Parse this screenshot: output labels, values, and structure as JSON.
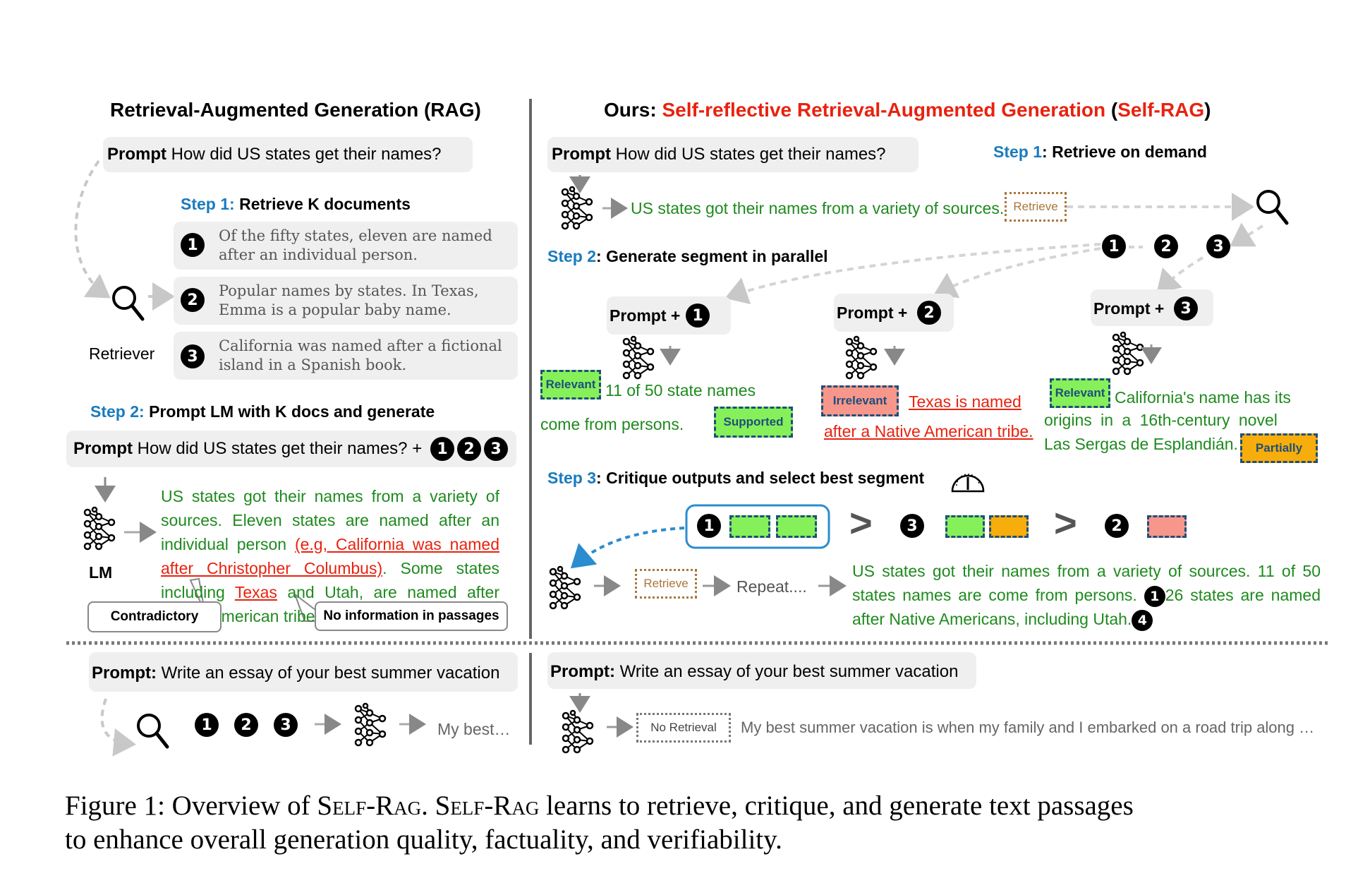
{
  "left": {
    "title": "Retrieval-Augmented Generation (RAG)",
    "prompt": {
      "label": "Prompt",
      "text": "How did US states get their names?"
    },
    "step1": {
      "step": "Step 1:",
      "text": "Retrieve K documents"
    },
    "retriever_label": "Retriever",
    "documents": [
      {
        "num": "1",
        "text": "Of the fifty states, eleven are named after an individual person."
      },
      {
        "num": "2",
        "text": "Popular names by states. In Texas, Emma is a popular baby name."
      },
      {
        "num": "3",
        "text": "California was named after a fictional island in a Spanish book."
      }
    ],
    "step2": {
      "step": "Step 2:",
      "text": "Prompt LM with K docs and generate"
    },
    "prompt2": {
      "label": "Prompt",
      "text": "How did US states get their names? +",
      "nums": [
        "1",
        "2",
        "3"
      ]
    },
    "lm_label": "LM",
    "generation": {
      "part1": "US states got their names from a variety of sources. Eleven states are named after an individual person ",
      "error1": "(e.g, California was named after Christopher Columbus)",
      "part2": ". Some states including ",
      "error2": "Texas",
      "part3": " and Utah, are named after Native American tribe."
    },
    "callouts": {
      "contradictory": "Contradictory",
      "no_info": "No information in passages"
    },
    "bottom": {
      "prompt_label": "Prompt:",
      "prompt_text": "Write an essay of your best summer vacation",
      "nums": [
        "1",
        "2",
        "3"
      ],
      "output": "My best…"
    }
  },
  "right": {
    "title_prefix": "Ours: ",
    "title_main": "Self-reflective Retrieval-Augmented Generation",
    "title_open": " (",
    "title_abbr": "Self-RAG",
    "title_close": ")",
    "prompt": {
      "label": "Prompt",
      "text": "How did US states get their names?"
    },
    "step1": {
      "step": "Step 1",
      "text": ": Retrieve on demand"
    },
    "first_output": "US states got their names from a variety of sources.",
    "retrieve_tag": "Retrieve",
    "retrieved_nums": [
      "1",
      "2",
      "3"
    ],
    "step2": {
      "step": "Step 2",
      "text": ": Generate segment in parallel"
    },
    "parallel": [
      {
        "prompt": "Prompt +",
        "num": "1",
        "tag_before": "Relevant",
        "text_line1": "11 of 50 state names",
        "text_line2": "come from persons.",
        "tag_after": "Supported"
      },
      {
        "prompt": "Prompt +",
        "num": "2",
        "tag_before": "Irrelevant",
        "text_line1": "Texas is named",
        "text_line2": "after a Native American tribe."
      },
      {
        "prompt": "Prompt +",
        "num": "3",
        "tag_before": "Relevant",
        "text_line1": "California's name has its",
        "text_line2": "origins in a 16th-century novel",
        "text_line3": "Las Sergas de Esplandián.",
        "tag_after": "Partially"
      }
    ],
    "step3": {
      "step": "Step 3",
      "text": ": Critique outputs and select best segment"
    },
    "ranking": [
      {
        "num": "1",
        "tags": [
          "green",
          "green"
        ]
      },
      {
        "num": "3",
        "tags": [
          "green",
          "orange"
        ]
      },
      {
        "num": "2",
        "tags": [
          "red"
        ]
      }
    ],
    "ranking_sep": ">",
    "loop": {
      "retrieve": "Retrieve",
      "repeat": "Repeat...."
    },
    "final_output": {
      "part1": "US states got their names from a variety of sources. 11 of 50 states names are come from persons.",
      "cite1": "1",
      "part2": "26 states are named after Native Americans, including Utah.",
      "cite2": "4"
    },
    "bottom": {
      "prompt_label": "Prompt:",
      "prompt_text": "Write an essay of your best summer vacation",
      "no_retrieval": "No Retrieval",
      "output": "My best summer vacation is when my family and I embarked on a road trip along …"
    }
  },
  "colors": {
    "accent_red": "#e8220f",
    "step_blue": "#1a7bbd",
    "gen_green": "#1f8a1f",
    "tag_green": "#86f05a",
    "tag_red": "#f7968b",
    "tag_orange": "#f7ad0b",
    "retrieve_brown": "#a9773b"
  },
  "caption": {
    "line1_a": "Figure 1: Overview of ",
    "name": "Self-Rag",
    "line1_b": ". ",
    "line1_c": " learns to retrieve, critique, and generate text passages",
    "line2": "to enhance overall generation quality, factuality, and verifiability."
  }
}
